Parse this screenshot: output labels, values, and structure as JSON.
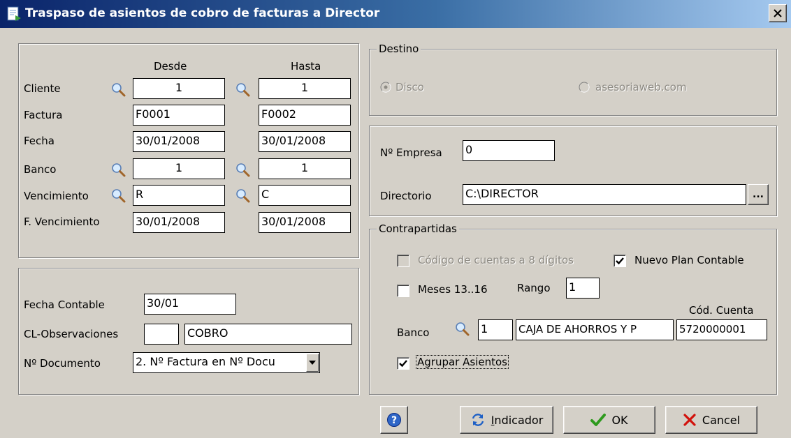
{
  "window": {
    "title": "Traspaso de asientos de cobro de facturas a Director"
  },
  "range": {
    "desde_header": "Desde",
    "hasta_header": "Hasta",
    "rows": [
      {
        "label": "Cliente",
        "desde": "1",
        "hasta": "1"
      },
      {
        "label": "Factura",
        "desde": "F0001",
        "hasta": "F0002"
      },
      {
        "label": "Fecha",
        "desde": "30/01/2008",
        "hasta": "30/01/2008"
      },
      {
        "label": "Banco",
        "desde": "1",
        "hasta": "1"
      },
      {
        "label": "Vencimiento",
        "desde": "R",
        "hasta": "C"
      },
      {
        "label": "F. Vencimiento",
        "desde": "30/01/2008",
        "hasta": "30/01/2008"
      }
    ]
  },
  "accounting": {
    "fecha_contable_label": "Fecha Contable",
    "fecha_contable_value": "30/01",
    "cl_observaciones_label": "CL-Observaciones",
    "cl_code": "",
    "cl_text": "COBRO",
    "n_documento_label": "Nº Documento",
    "n_documento_value": "2. Nº Factura en Nº Docu"
  },
  "destino": {
    "legend": "Destino",
    "options": [
      {
        "label": "Disco",
        "selected": true
      },
      {
        "label": "asesoriaweb.com",
        "selected": false
      }
    ]
  },
  "empresa": {
    "n_empresa_label": "Nº Empresa",
    "n_empresa_value": "0",
    "directorio_label": "Directorio",
    "directorio_value": "C:\\DIRECTOR",
    "browse_label": "..."
  },
  "contrapartidas": {
    "legend": "Contrapartidas",
    "codigo_8_label": "Código de cuentas a 8 dígitos",
    "codigo_8_checked": false,
    "nuevo_plan_label": "Nuevo Plan Contable",
    "nuevo_plan_checked": true,
    "meses_label": "Meses 13..16",
    "meses_checked": false,
    "rango_label": "Rango",
    "rango_value": "1",
    "cod_cuenta_header": "Cód. Cuenta",
    "banco_label": "Banco",
    "banco_code": "1",
    "banco_name": "CAJA DE AHORROS Y P",
    "banco_cuenta": "5720000001",
    "agrupar_label": "Agrupar Asientos",
    "agrupar_checked": true
  },
  "buttons": {
    "indicador_prefix": "I",
    "indicador_rest": "ndicador",
    "ok": "OK",
    "cancel": "Cancel"
  },
  "colors": {
    "title_start": "#0a246a",
    "title_end": "#a6caf0",
    "face": "#d4d0c8",
    "ok_check": "#2e9a1e",
    "cancel_x": "#d2120c"
  }
}
